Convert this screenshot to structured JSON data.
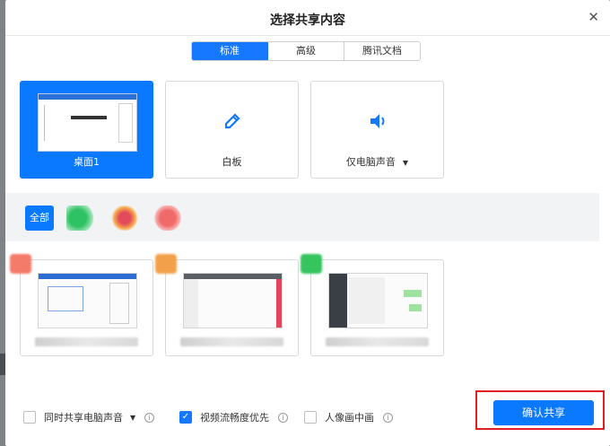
{
  "dialog": {
    "title": "选择共享内容"
  },
  "tabs": [
    {
      "label": "标准",
      "active": true
    },
    {
      "label": "高级",
      "active": false
    },
    {
      "label": "腾讯文档",
      "active": false
    }
  ],
  "sources": [
    {
      "label": "桌面1",
      "icon": "desktop-thumbnail"
    },
    {
      "label": "白板",
      "icon": "pen-icon"
    },
    {
      "label": "仅电脑声音",
      "icon": "speaker-icon"
    }
  ],
  "filters": {
    "all_label": "全部"
  },
  "windows": [
    {
      "badge_color": "#f47a6a"
    },
    {
      "badge_color": "#f2a14a"
    },
    {
      "badge_color": "#35c45e"
    }
  ],
  "options": {
    "share_audio": {
      "label": "同时共享电脑声音",
      "checked": false
    },
    "smooth_video": {
      "label": "视频流畅度优先",
      "checked": true
    },
    "portrait_pip": {
      "label": "人像画中画",
      "checked": false
    }
  },
  "confirm_label": "确认共享",
  "colors": {
    "accent": "#0a78ff",
    "highlight_border": "#e02020"
  }
}
